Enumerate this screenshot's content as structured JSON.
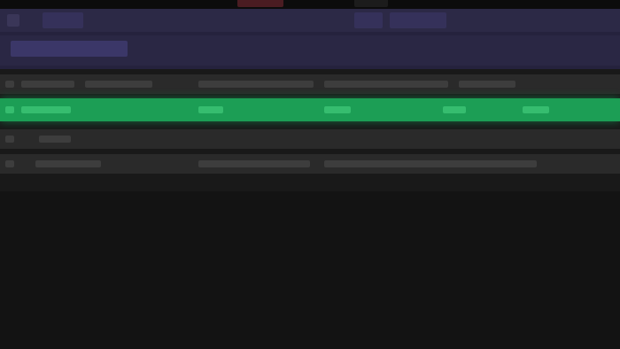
{
  "window": {
    "buttons": [
      {
        "name": "window-control-red",
        "color": "#5a1d24"
      },
      {
        "name": "window-control-dark",
        "color": "#1e1e1e"
      }
    ]
  },
  "header": {
    "tabs": [
      {
        "name": "column-tab"
      },
      {
        "name": "column-tab"
      },
      {
        "name": "column-tab"
      }
    ]
  },
  "table": {
    "rows": [
      {
        "state": "normal"
      },
      {
        "state": "selected"
      },
      {
        "state": "normal"
      },
      {
        "state": "normal"
      }
    ]
  },
  "colors": {
    "header_bg": "#2c2946",
    "selected_row": "#1c9e55",
    "row_bg": "#2a2a2a",
    "background": "#131313"
  }
}
